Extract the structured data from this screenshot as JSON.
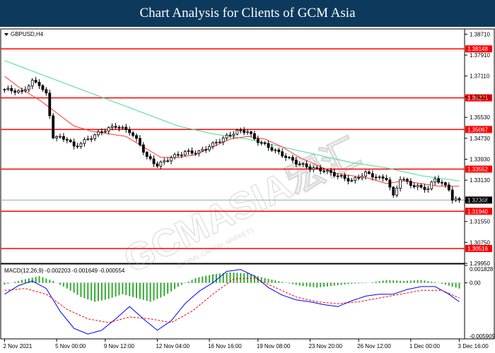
{
  "banner_title": "Chart Analysis for Clients of GCM Asia",
  "watermark": "GCMASIA宏汇",
  "watermark_sub": "GLOBAL CAPITAL MARKETS",
  "colors": {
    "banner": "#0d3a5c",
    "level_line": "#ff0000",
    "current_price_line": "#9aa4ad",
    "ma_fast": "#ff3333",
    "ma_slow": "#44dd99",
    "candle": "#000000",
    "macd_hist": "#33aa33",
    "macd_line": "#0000ff",
    "macd_signal": "#ff0000"
  },
  "chart_data": [
    {
      "type": "candlestick",
      "symbol_label": "GBPUSD,H4",
      "ylim": [
        1.2995,
        1.3891
      ],
      "y_ticks": [
        "1.38710",
        "1.37910",
        "1.37110",
        "1.36310",
        "1.35530",
        "1.34730",
        "1.33930",
        "1.33130",
        "1.32350",
        "1.31550",
        "1.30750",
        "1.29950"
      ],
      "x_ticks": [
        "2 Nov 2021",
        "5 Nov 00:00",
        "9 Nov 12:00",
        "12 Nov 04:00",
        "16 Nov 16:00",
        "19 Nov 08:00",
        "23 Nov 20:00",
        "26 Nov 12:00",
        "1 Dec 00:00",
        "3 Dec 16:00"
      ],
      "levels": [
        "1.38148",
        "1.36276",
        "1.35067",
        "1.33552",
        "1.31940",
        "1.30516"
      ],
      "current_price": "1.32368",
      "close_path": [
        [
          0,
          1.366
        ],
        [
          5,
          1.365
        ],
        [
          8,
          1.369
        ],
        [
          10,
          1.368
        ],
        [
          12,
          1.364
        ],
        [
          14,
          1.348
        ],
        [
          18,
          1.347
        ],
        [
          20,
          1.344
        ],
        [
          24,
          1.347
        ],
        [
          28,
          1.35
        ],
        [
          32,
          1.352
        ],
        [
          36,
          1.35
        ],
        [
          39,
          1.345
        ],
        [
          41,
          1.34
        ],
        [
          44,
          1.337
        ],
        [
          48,
          1.34
        ],
        [
          52,
          1.342
        ],
        [
          56,
          1.342
        ],
        [
          60,
          1.345
        ],
        [
          64,
          1.348
        ],
        [
          67,
          1.35
        ],
        [
          70,
          1.35
        ],
        [
          72,
          1.347
        ],
        [
          76,
          1.344
        ],
        [
          80,
          1.341
        ],
        [
          84,
          1.338
        ],
        [
          88,
          1.336
        ],
        [
          92,
          1.335
        ],
        [
          96,
          1.333
        ],
        [
          100,
          1.331
        ],
        [
          104,
          1.334
        ],
        [
          108,
          1.332
        ],
        [
          110,
          1.332
        ],
        [
          112,
          1.325
        ],
        [
          114,
          1.332
        ],
        [
          118,
          1.329
        ],
        [
          122,
          1.328
        ],
        [
          124,
          1.332
        ],
        [
          126,
          1.33
        ],
        [
          128,
          1.328
        ],
        [
          129,
          1.324
        ],
        [
          131,
          1.3235
        ]
      ],
      "ma_fast_path": [
        [
          0,
          1.371
        ],
        [
          5,
          1.366
        ],
        [
          10,
          1.362
        ],
        [
          15,
          1.357
        ],
        [
          20,
          1.352
        ],
        [
          25,
          1.35
        ],
        [
          30,
          1.349
        ],
        [
          35,
          1.348
        ],
        [
          40,
          1.344
        ],
        [
          45,
          1.34
        ],
        [
          50,
          1.34
        ],
        [
          55,
          1.341
        ],
        [
          60,
          1.344
        ],
        [
          65,
          1.347
        ],
        [
          70,
          1.348
        ],
        [
          75,
          1.347
        ],
        [
          80,
          1.344
        ],
        [
          85,
          1.34
        ],
        [
          90,
          1.337
        ],
        [
          95,
          1.334
        ],
        [
          100,
          1.333
        ],
        [
          105,
          1.332
        ],
        [
          110,
          1.33
        ],
        [
          115,
          1.331
        ],
        [
          120,
          1.33
        ],
        [
          125,
          1.329
        ],
        [
          131,
          1.329
        ]
      ],
      "ma_slow_path": [
        [
          0,
          1.377
        ],
        [
          10,
          1.372
        ],
        [
          20,
          1.367
        ],
        [
          30,
          1.362
        ],
        [
          40,
          1.357
        ],
        [
          50,
          1.352
        ],
        [
          60,
          1.349
        ],
        [
          70,
          1.347
        ],
        [
          80,
          1.344
        ],
        [
          90,
          1.341
        ],
        [
          100,
          1.338
        ],
        [
          110,
          1.336
        ],
        [
          120,
          1.333
        ],
        [
          131,
          1.331
        ]
      ]
    },
    {
      "type": "macd",
      "label": "MACD(12,26,9) -0.002203 -0.001649 -0.000554",
      "ylim": [
        -0.005909,
        0.001828
      ],
      "y_ticks": [
        "0.001828",
        "0.00",
        "-0.005909"
      ],
      "histogram_path": [
        [
          0,
          -0.0002
        ],
        [
          5,
          0.0003
        ],
        [
          10,
          0.0007
        ],
        [
          14,
          0.0002
        ],
        [
          18,
          -0.0006
        ],
        [
          22,
          -0.0015
        ],
        [
          26,
          -0.002
        ],
        [
          30,
          -0.0017
        ],
        [
          34,
          -0.0012
        ],
        [
          38,
          -0.0016
        ],
        [
          42,
          -0.002
        ],
        [
          46,
          -0.0014
        ],
        [
          50,
          -0.0004
        ],
        [
          55,
          0.0005
        ],
        [
          60,
          0.0009
        ],
        [
          65,
          0.0011
        ],
        [
          70,
          0.001
        ],
        [
          75,
          0.0005
        ],
        [
          80,
          0.0001
        ],
        [
          85,
          -0.0003
        ],
        [
          90,
          -0.0005
        ],
        [
          95,
          -0.0003
        ],
        [
          100,
          -0.0001
        ],
        [
          105,
          0.0
        ],
        [
          110,
          0.0003
        ],
        [
          115,
          0.0002
        ],
        [
          120,
          0.0003
        ],
        [
          125,
          0.0
        ],
        [
          131,
          -0.0006
        ]
      ],
      "macd_path": [
        [
          0,
          -0.0012
        ],
        [
          4,
          -0.0003
        ],
        [
          8,
          0.0002
        ],
        [
          12,
          -0.0006
        ],
        [
          16,
          -0.003
        ],
        [
          20,
          -0.0048
        ],
        [
          24,
          -0.0054
        ],
        [
          28,
          -0.005
        ],
        [
          32,
          -0.0038
        ],
        [
          36,
          -0.0025
        ],
        [
          40,
          -0.0038
        ],
        [
          44,
          -0.005
        ],
        [
          48,
          -0.004
        ],
        [
          52,
          -0.0022
        ],
        [
          56,
          -0.0009
        ],
        [
          60,
          0.0
        ],
        [
          64,
          0.0012
        ],
        [
          68,
          0.0014
        ],
        [
          72,
          0.0007
        ],
        [
          76,
          -0.0005
        ],
        [
          80,
          -0.0013
        ],
        [
          84,
          -0.0018
        ],
        [
          88,
          -0.002
        ],
        [
          92,
          -0.0023
        ],
        [
          96,
          -0.0025
        ],
        [
          100,
          -0.0019
        ],
        [
          104,
          -0.0014
        ],
        [
          108,
          -0.0012
        ],
        [
          112,
          -0.0012
        ],
        [
          116,
          -0.0007
        ],
        [
          120,
          -0.0004
        ],
        [
          124,
          -0.0004
        ],
        [
          128,
          -0.0012
        ],
        [
          131,
          -0.002
        ]
      ],
      "signal_path": [
        [
          0,
          -0.0008
        ],
        [
          6,
          -0.0006
        ],
        [
          12,
          -0.0012
        ],
        [
          18,
          -0.0028
        ],
        [
          24,
          -0.0038
        ],
        [
          30,
          -0.0042
        ],
        [
          36,
          -0.0036
        ],
        [
          42,
          -0.0038
        ],
        [
          48,
          -0.0042
        ],
        [
          54,
          -0.003
        ],
        [
          60,
          -0.0012
        ],
        [
          66,
          0.0004
        ],
        [
          72,
          0.0005
        ],
        [
          78,
          -0.0005
        ],
        [
          84,
          -0.0015
        ],
        [
          90,
          -0.002
        ],
        [
          96,
          -0.0022
        ],
        [
          102,
          -0.002
        ],
        [
          108,
          -0.0016
        ],
        [
          114,
          -0.0012
        ],
        [
          120,
          -0.0008
        ],
        [
          126,
          -0.0008
        ],
        [
          131,
          -0.0016
        ]
      ]
    }
  ]
}
